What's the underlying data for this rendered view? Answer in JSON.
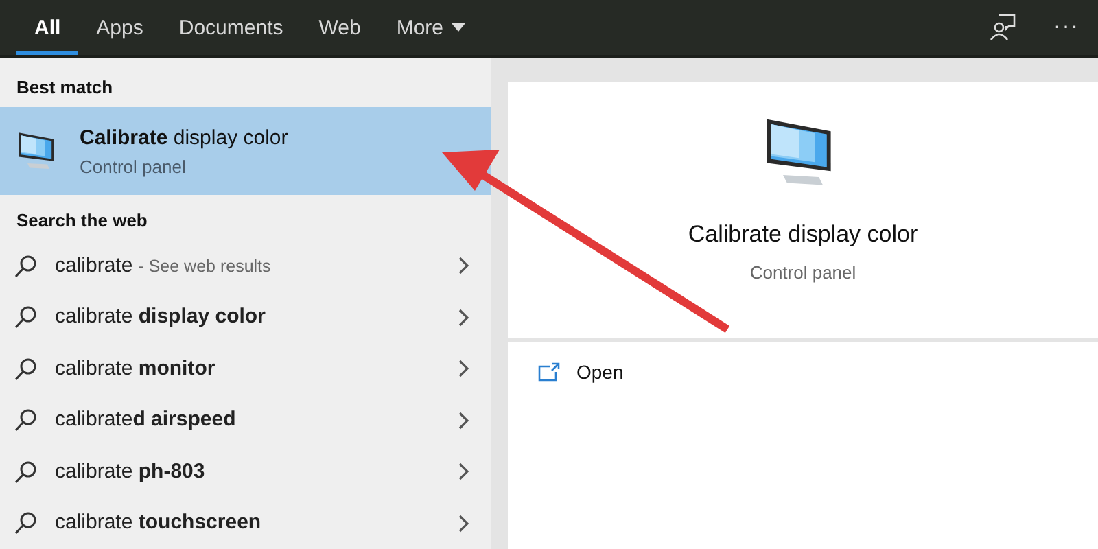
{
  "tabs": [
    {
      "label": "All",
      "selected": true
    },
    {
      "label": "Apps",
      "selected": false
    },
    {
      "label": "Documents",
      "selected": false
    },
    {
      "label": "Web",
      "selected": false
    },
    {
      "label": "More",
      "selected": false,
      "kind": "dropdown"
    }
  ],
  "more_menu": "···",
  "best_match": {
    "heading": "Best match",
    "title": "**Calibrate** display color",
    "subtitle": "Control panel",
    "selected": true
  },
  "web": {
    "heading": "Search the web",
    "items": [
      {
        "query": "calibrate",
        "hint": "- See web results"
      },
      {
        "query": "calibrate **display color**"
      },
      {
        "query": "calibrate **monitor**"
      },
      {
        "query": "calibrate**d airspeed**"
      },
      {
        "query": "calibrate **ph-803**"
      },
      {
        "query": "calibrate **touchscreen**"
      }
    ]
  },
  "preview": {
    "title": "Calibrate display color",
    "subtitle": "Control panel",
    "actions": [
      {
        "label": "Open"
      }
    ]
  }
}
